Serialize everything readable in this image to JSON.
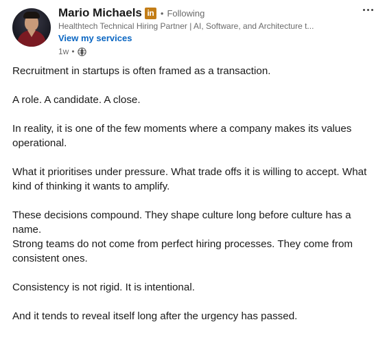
{
  "author": {
    "name": "Mario Michaels",
    "badge_text": "in",
    "separator": "•",
    "follow_status": "Following",
    "headline": "Healthtech Technical Hiring Partner | AI, Software, and Architecture t...",
    "services_link": "View my services",
    "posted_age": "1w",
    "meta_separator": "•",
    "visibility_icon": "globe-icon"
  },
  "menu": {
    "icon": "more-options-icon"
  },
  "post": {
    "paragraphs": [
      "Recruitment in startups is often framed as a transaction.",
      "A role. A candidate. A close.",
      "In reality, it is one of the few moments where a company makes its values operational.",
      "What it prioritises under pressure. What trade offs it is willing to accept. What kind of thinking it wants to amplify.",
      "These decisions compound. They shape culture long before culture has a name.",
      "Strong teams do not come from perfect hiring processes. They come from consistent ones.",
      "Consistency is not rigid. It is intentional.",
      "And it tends to reveal itself long after the urgency has passed."
    ]
  },
  "colors": {
    "brand_link": "#0a66c2",
    "badge_bg": "#c37d16",
    "text_primary": "rgba(0,0,0,0.9)",
    "text_secondary": "rgba(0,0,0,0.6)"
  }
}
